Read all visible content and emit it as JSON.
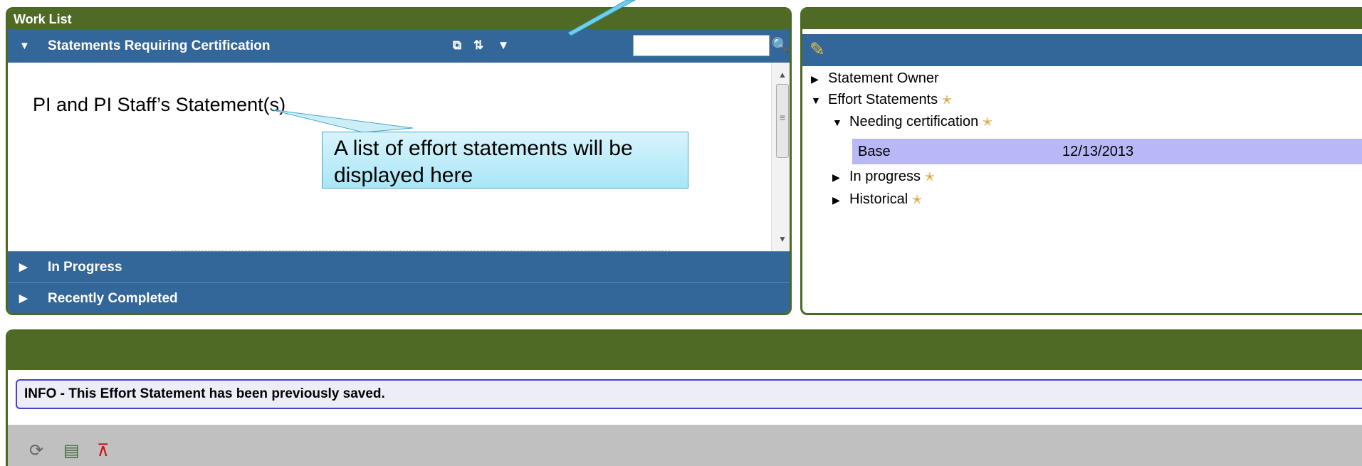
{
  "worklist": {
    "title": "Work List",
    "sections": [
      {
        "label": "Statements Requiring Certification",
        "expanded": true
      },
      {
        "label": "In Progress",
        "expanded": false
      },
      {
        "label": "Recently Completed",
        "expanded": false
      }
    ],
    "list_title": "PI and PI Staff’s Statement(s)",
    "search": {
      "value": "",
      "placeholder": ""
    },
    "tool_icons": [
      "select-all-icon",
      "sort-icon",
      "filter-icon",
      "search-icon"
    ]
  },
  "callout": {
    "text_line1": "A list of effort statements will be",
    "text_line2": "displayed here"
  },
  "statement_panel": {
    "tree": {
      "owner": "Statement Owner",
      "effort": "Effort Statements",
      "needing": "Needing certification",
      "in_progress": "In progress",
      "historical": "Historical"
    },
    "base_row": {
      "label": "Base",
      "date": "12/13/2013"
    }
  },
  "bottom": {
    "info": "INFO - This Effort Statement has been previously saved.",
    "action_icons": [
      "refresh-icon",
      "report-icon",
      "pdf-icon"
    ]
  },
  "colors": {
    "header_green": "#4f6a25",
    "section_blue": "#336699",
    "highlight_row": "#b8b8f6",
    "star": "#d39a2a"
  }
}
